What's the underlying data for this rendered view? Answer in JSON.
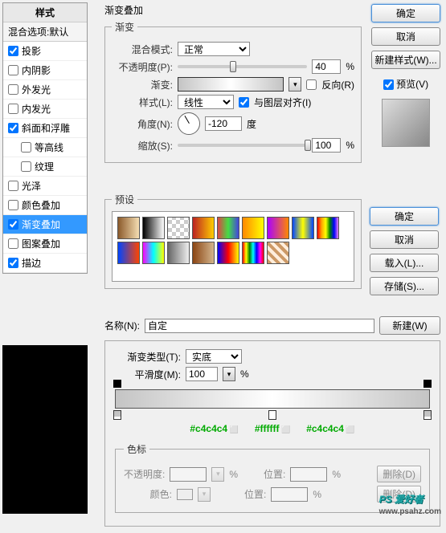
{
  "sidebar": {
    "title": "样式",
    "subtitle": "混合选项:默认",
    "items": [
      {
        "label": "投影",
        "checked": true
      },
      {
        "label": "内阴影",
        "checked": false
      },
      {
        "label": "外发光",
        "checked": false
      },
      {
        "label": "内发光",
        "checked": false
      },
      {
        "label": "斜面和浮雕",
        "checked": true
      },
      {
        "label": "等高线",
        "checked": false,
        "indent": true
      },
      {
        "label": "纹理",
        "checked": false,
        "indent": true
      },
      {
        "label": "光泽",
        "checked": false
      },
      {
        "label": "颜色叠加",
        "checked": false
      },
      {
        "label": "渐变叠加",
        "checked": true,
        "selected": true
      },
      {
        "label": "图案叠加",
        "checked": false
      },
      {
        "label": "描边",
        "checked": true
      }
    ]
  },
  "main": {
    "title": "渐变叠加",
    "gradient_section": "渐变",
    "blend_mode_label": "混合模式:",
    "blend_mode_value": "正常",
    "opacity_label": "不透明度(P):",
    "opacity_value": "40",
    "opacity_unit": "%",
    "gradient_label": "渐变:",
    "reverse_label": "反向(R)",
    "style_label": "样式(L):",
    "style_value": "线性",
    "align_label": "与图层对齐(I)",
    "angle_label": "角度(N):",
    "angle_value": "-120",
    "angle_unit": "度",
    "scale_label": "缩放(S):",
    "scale_value": "100",
    "scale_unit": "%"
  },
  "presets": {
    "title": "预设"
  },
  "buttons": {
    "ok": "确定",
    "cancel": "取消",
    "new_style": "新建样式(W)...",
    "preview": "预览(V)",
    "ok2": "确定",
    "cancel2": "取消",
    "load": "载入(L)...",
    "save": "存储(S)...",
    "new": "新建(W)"
  },
  "name_row": {
    "label": "名称(N):",
    "value": "自定"
  },
  "editor": {
    "type_label": "渐变类型(T):",
    "type_value": "实底",
    "smooth_label": "平滑度(M):",
    "smooth_value": "100",
    "smooth_unit": "%",
    "colors": [
      "#c4c4c4",
      "#ffffff",
      "#c4c4c4"
    ],
    "sebiao_title": "色标",
    "opacity_label": "不透明度:",
    "pos_label": "位置:",
    "pct": "%",
    "delete_label": "删除(D)",
    "color_label": "颜色:"
  },
  "watermark": {
    "big": "PS 爱好者",
    "url": "www.psahz.com"
  }
}
